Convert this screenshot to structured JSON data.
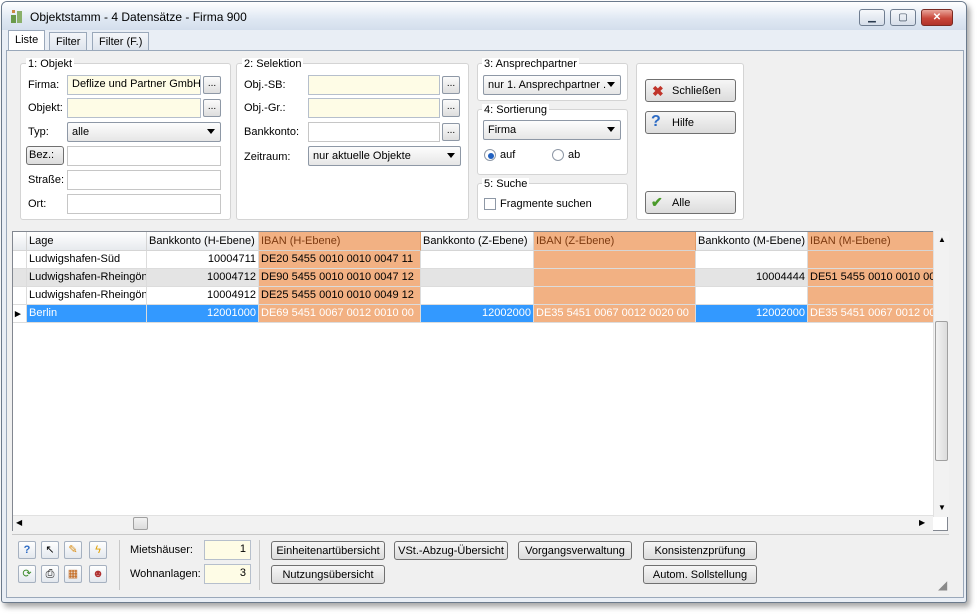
{
  "window": {
    "title": "Objektstamm - 4 Datensätze - Firma 900"
  },
  "tabs": [
    {
      "label": "Liste"
    },
    {
      "label": "Filter"
    },
    {
      "label": "Filter (F.)"
    }
  ],
  "objekt": {
    "title": "1: Objekt",
    "firma_label": "Firma:",
    "firma_value": "Deflize und Partner GmbH",
    "objekt_label": "Objekt:",
    "objekt_value": "",
    "typ_label": "Typ:",
    "typ_value": "alle",
    "bez_label": "Bez.:",
    "bez_value": "",
    "strasse_label": "Straße:",
    "strasse_value": "",
    "ort_label": "Ort:",
    "ort_value": ""
  },
  "selektion": {
    "title": "2: Selektion",
    "objsb_label": "Obj.-SB:",
    "objsb_value": "",
    "objgr_label": "Obj.-Gr.:",
    "objgr_value": "",
    "bankkonto_label": "Bankkonto:",
    "bankkonto_value": "",
    "zeitraum_label": "Zeitraum:",
    "zeitraum_value": "nur aktuelle Objekte"
  },
  "ansprechpartner": {
    "title": "3: Ansprechpartner",
    "value": "nur 1. Ansprechpartner ."
  },
  "sortierung": {
    "title": "4: Sortierung",
    "value": "Firma",
    "auf": "auf",
    "ab": "ab",
    "selected": "auf"
  },
  "suche": {
    "title": "5: Suche",
    "fragmente": "Fragmente suchen",
    "checked": false
  },
  "actions": {
    "schliessen": "Schließen",
    "hilfe": "Hilfe",
    "alle": "Alle"
  },
  "grid": {
    "headers": [
      "Lage",
      "Bankkonto (H-Ebene)",
      "IBAN (H-Ebene)",
      "Bankkonto (Z-Ebene)",
      "IBAN (Z-Ebene)",
      "Bankkonto (M-Ebene)",
      "IBAN (M-Ebene)"
    ],
    "rows": [
      [
        "Ludwigshafen-Süd",
        "10004711",
        "DE20 5455 0010 0010 0047 11",
        "",
        "",
        "",
        ""
      ],
      [
        "Ludwigshafen-Rheingönl",
        "10004712",
        "DE90 5455 0010 0010 0047 12",
        "",
        "",
        "10004444",
        "DE51 5455 0010 0010 00"
      ],
      [
        "Ludwigshafen-Rheingönl",
        "10004912",
        "DE25 5455 0010 0010 0049 12",
        "",
        "",
        "",
        ""
      ],
      [
        "Berlin",
        "12001000",
        "DE69 5451 0067 0012 0010 00",
        "12002000",
        "DE35 5451 0067 0012 0020 00",
        "12002000",
        "DE35 5451 0067 0012 00"
      ]
    ],
    "selected_row": 3,
    "highlight_color": "#f2b183",
    "selection_color": "#3399ff"
  },
  "footer": {
    "mietshaeuser_label": "Mietshäuser:",
    "mietshaeuser_value": "1",
    "wohnanlagen_label": "Wohnanlagen:",
    "wohnanlagen_value": "3",
    "buttons": [
      "Einheitenartübersicht",
      "VSt.-Abzug-Übersicht",
      "Vorgangsverwaltung",
      "Konsistenzprüfung",
      "Nutzungsübersicht",
      "Autom. Sollstellung"
    ]
  },
  "icons": [
    "help-icon",
    "pointer-icon",
    "edit-icon",
    "lightning-icon",
    "refresh-icon",
    "print-icon",
    "calendar-icon",
    "users-icon"
  ]
}
